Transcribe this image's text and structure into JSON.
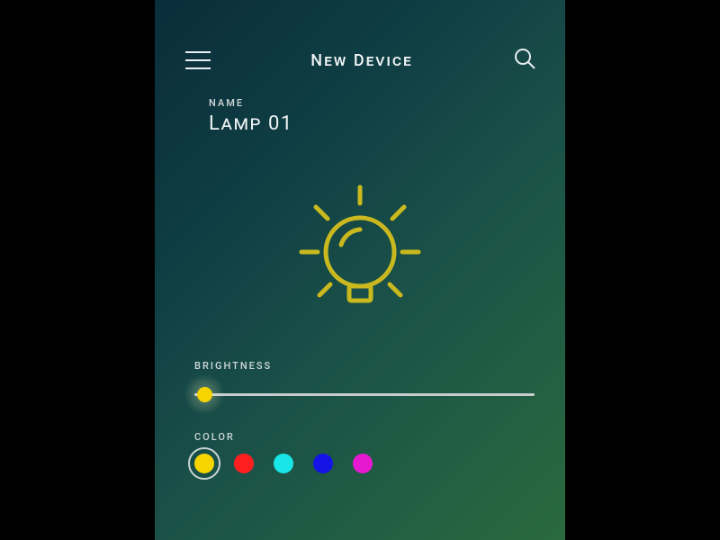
{
  "header": {
    "title": "New Device"
  },
  "name": {
    "label": "NAME",
    "value": "Lamp 01"
  },
  "brightness": {
    "label": "BRIGHTNESS",
    "percent": 3
  },
  "color": {
    "label": "COLOR",
    "options": [
      {
        "name": "yellow",
        "hex": "#f5d400",
        "selected": true
      },
      {
        "name": "red",
        "hex": "#ff1f1f",
        "selected": false
      },
      {
        "name": "cyan",
        "hex": "#19e6e6",
        "selected": false
      },
      {
        "name": "blue",
        "hex": "#1414e6",
        "selected": false
      },
      {
        "name": "magenta",
        "hex": "#e619d1",
        "selected": false
      }
    ]
  },
  "icons": {
    "menu": "menu-icon",
    "search": "search-icon",
    "bulb": "bulb-icon",
    "bulb_color": "#c9b81e"
  }
}
